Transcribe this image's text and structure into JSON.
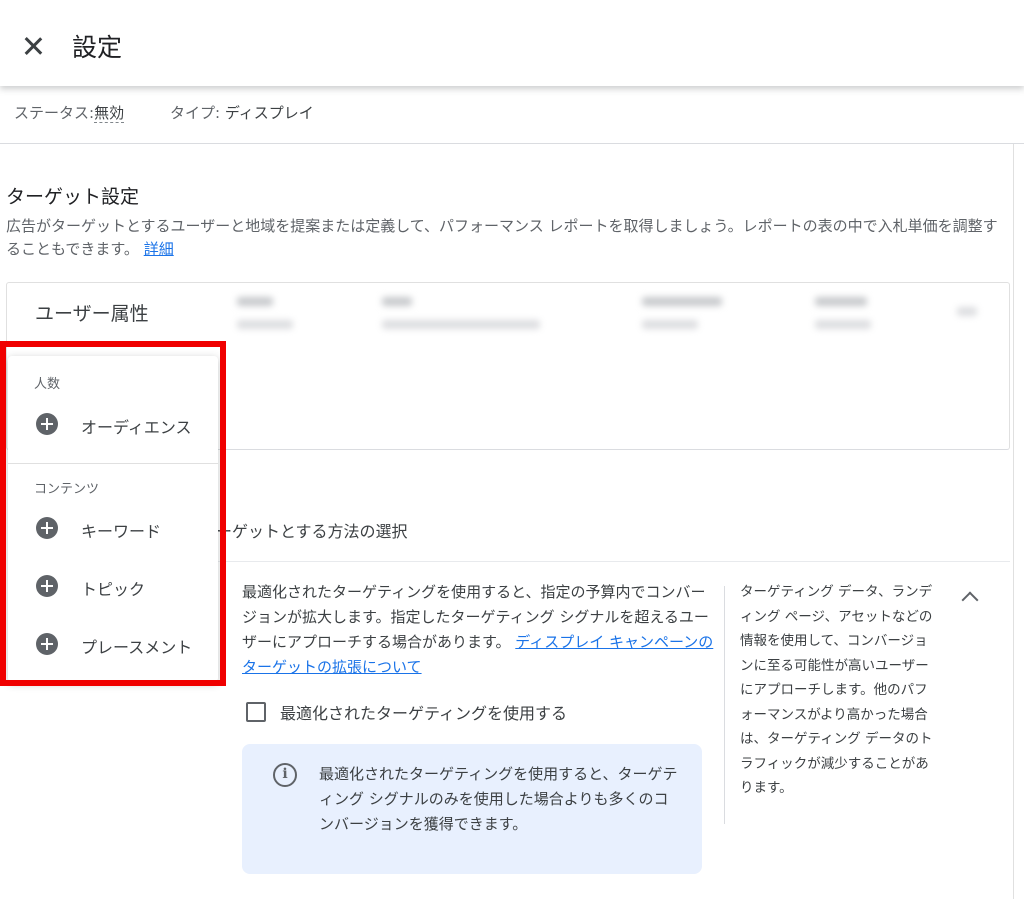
{
  "header": {
    "title": "設定"
  },
  "status_bar": {
    "status_label": "ステータス:",
    "status_value": "無効",
    "type_label": "タイプ:",
    "type_value": "ディスプレイ"
  },
  "target_settings": {
    "title": "ターゲット設定",
    "description": "広告がターゲットとするユーザーと地域を提案または定義して、パフォーマンス レポートを取得しましょう。レポートの表の中で入札単価を調整することもできます。",
    "details_link": "詳細",
    "demographics_card_title": "ユーザー属性"
  },
  "menu": {
    "groups": [
      {
        "label": "人数",
        "items": [
          {
            "label": "オーディエンス"
          }
        ]
      },
      {
        "label": "コンテンツ",
        "items": [
          {
            "label": "キーワード"
          },
          {
            "label": "トピック"
          },
          {
            "label": "プレースメント"
          }
        ]
      }
    ]
  },
  "method": {
    "partial_text": "ーゲットとする方法の選択"
  },
  "optimized": {
    "description": "最適化されたターゲティングを使用すると、指定の予算内でコンバージョンが拡大します。指定したターゲティング シグナルを超えるユーザーにアプローチする場合があります。",
    "link": "ディスプレイ キャンペーンのターゲットの拡張について",
    "side_description": "ターゲティング データ、ランディング ページ、アセットなどの情報を使用して、コンバージョンに至る可能性が高いユーザーにアプローチします。他のパフォーマンスがより高かった場合は、ターゲティング データのトラフィックが減少することがあります。",
    "checkbox_label": "最適化されたターゲティングを使用する",
    "checkbox_checked": false,
    "info_text": "最適化されたターゲティングを使用すると、ターゲティング シグナルのみを使用した場合よりも多くのコンバージョンを獲得できます。"
  },
  "colors": {
    "highlight": "#f00000",
    "link": "#1a73e8",
    "info_bg": "#e8f0fe",
    "icon": "#5f6368"
  }
}
